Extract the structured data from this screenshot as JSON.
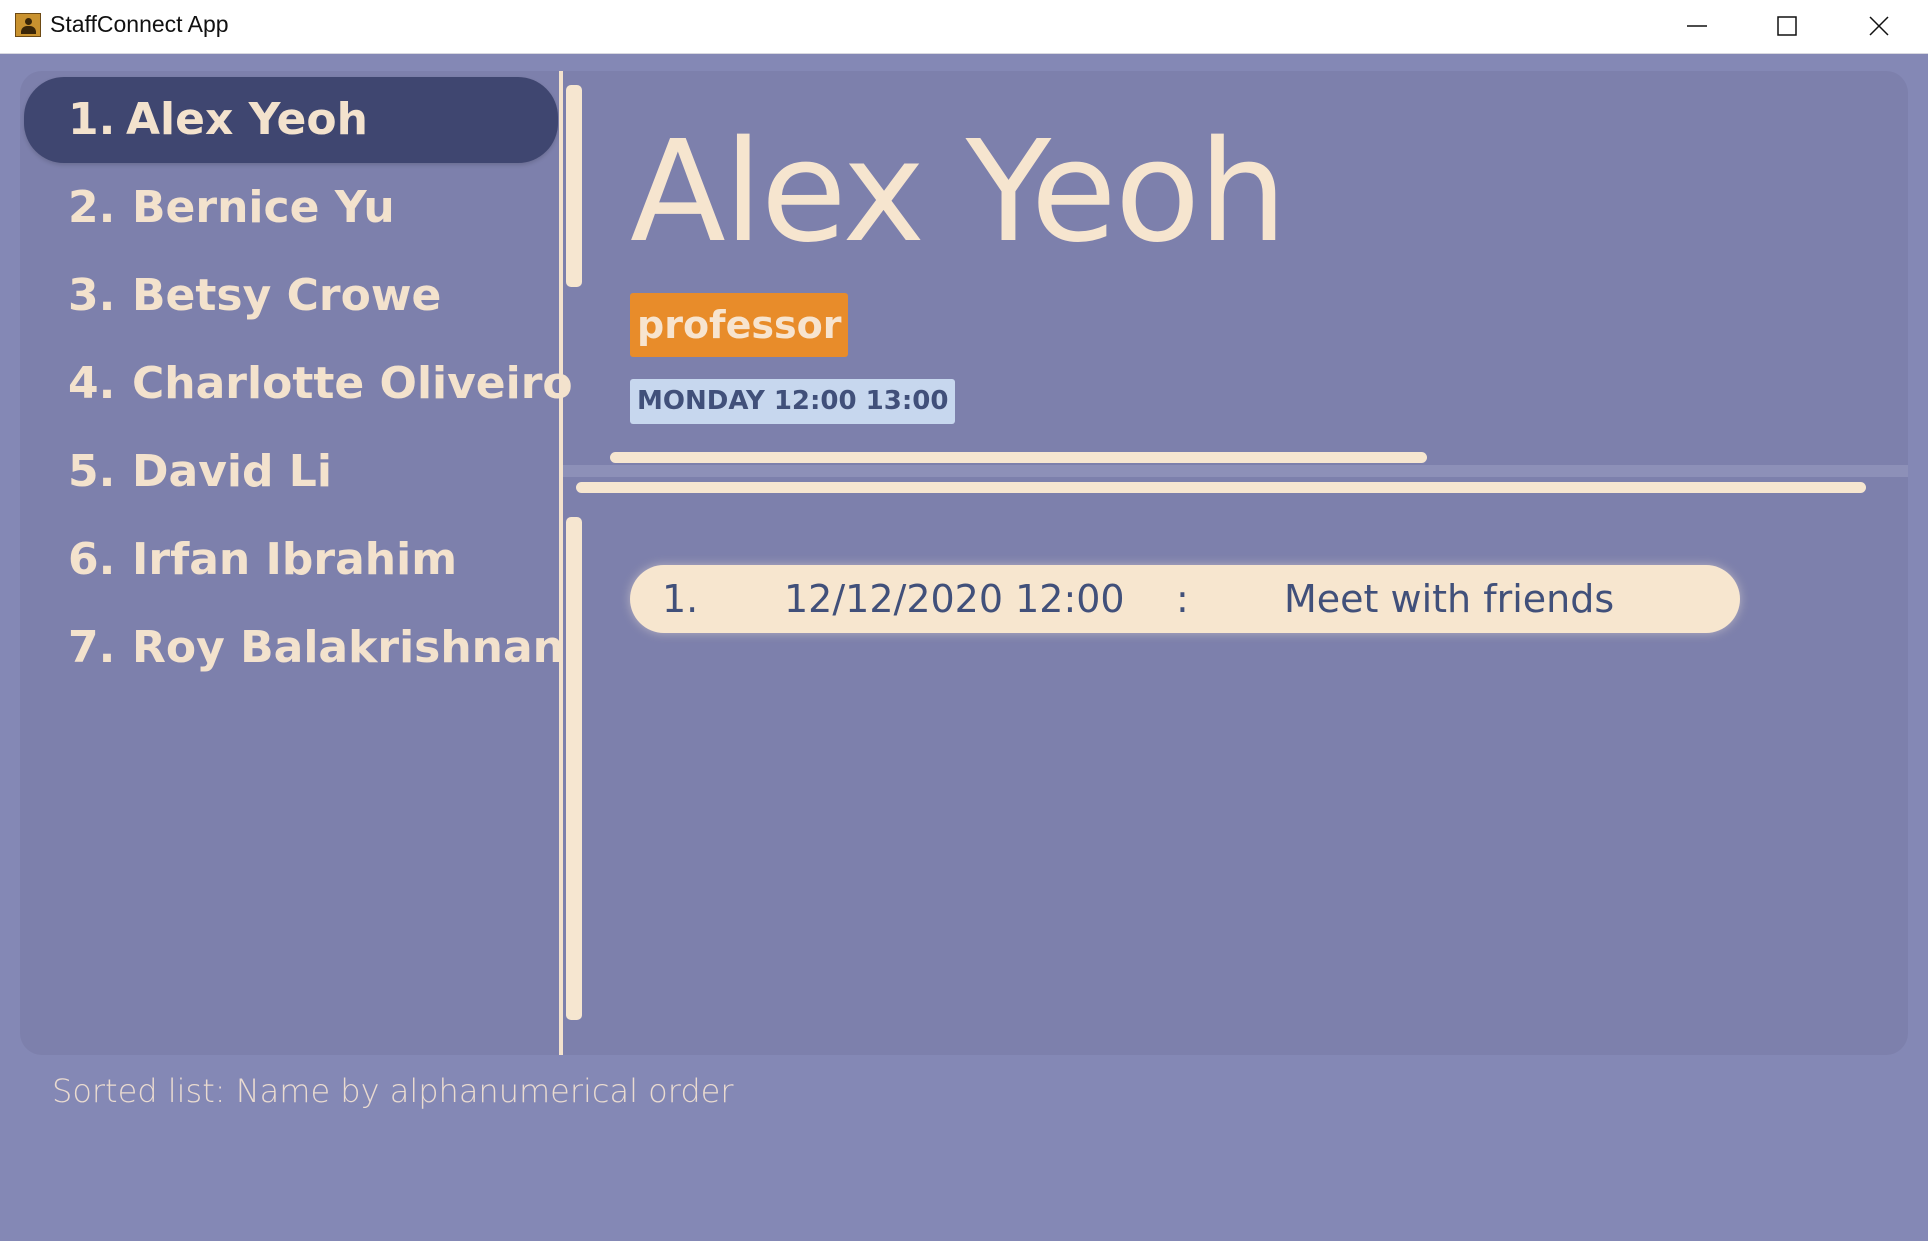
{
  "window": {
    "title": "StaffConnect App",
    "app_icon": "person-card-icon",
    "controls": [
      "minimize-icon",
      "maximize-icon",
      "close-icon"
    ]
  },
  "staff_list": [
    {
      "index": "1.",
      "name": "Alex Yeoh"
    },
    {
      "index": "2.",
      "name": "Bernice Yu"
    },
    {
      "index": "3.",
      "name": "Betsy Crowe"
    },
    {
      "index": "4.",
      "name": "Charlotte Oliveiro"
    },
    {
      "index": "5.",
      "name": "David Li"
    },
    {
      "index": "6.",
      "name": "Irfan Ibrahim"
    },
    {
      "index": "7.",
      "name": "Roy Balakrishnan"
    }
  ],
  "selected_index": 0,
  "detail": {
    "name": "Alex Yeoh",
    "tags": [
      "professor"
    ],
    "availabilities": [
      "MONDAY 12:00 13:00"
    ],
    "meetings": [
      {
        "index": "1.",
        "datetime": "12/12/2020 12:00",
        "separator": ":",
        "description": "Meet with friends"
      }
    ]
  },
  "status_bar": {
    "text": "Sorted list: Name by alphanumerical order"
  },
  "colors": {
    "background": "#8488b5",
    "panel": "#7d80ac",
    "selected_item": "#3f4670",
    "text_light": "#f3e2cd",
    "tag_orange": "#e88c2a",
    "availability_blue": "#c7d7ee",
    "meeting_card": "#f7e6cf"
  }
}
